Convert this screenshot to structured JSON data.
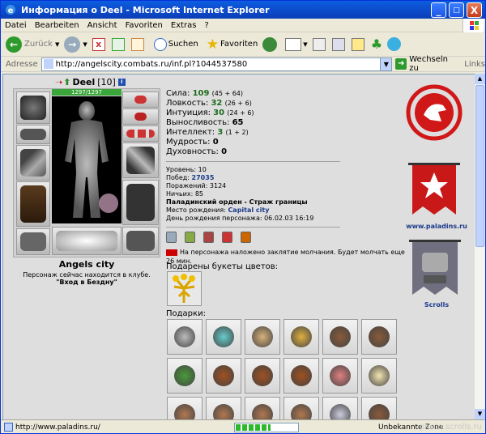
{
  "window": {
    "title": "Информация о Deel - Microsoft Internet Explorer",
    "minimize": "_",
    "maximize": "□",
    "close": "X"
  },
  "menu": [
    "Datei",
    "Bearbeiten",
    "Ansicht",
    "Favoriten",
    "Extras",
    "?"
  ],
  "toolbar": {
    "back": "Zurück",
    "search": "Suchen",
    "favorites": "Favoriten"
  },
  "address": {
    "label": "Adresse",
    "url": "http://angelscity.combats.ru/inf.pl?1044537580",
    "go": "Wechseln zu",
    "links": "Links"
  },
  "character": {
    "name": "Deel",
    "level": "[10]",
    "hp": "1297/1297"
  },
  "location": {
    "city": "Angels city",
    "message": "Персонаж сейчас находится в клубе.",
    "club": "\"Вход в Бездну\""
  },
  "stats": [
    {
      "label": "Сила:",
      "value": "109",
      "mod": "(45 + 64)"
    },
    {
      "label": "Ловкость:",
      "value": "32",
      "mod": "(26 + 6)"
    },
    {
      "label": "Интуиция:",
      "value": "30",
      "mod": "(24 + 6)"
    },
    {
      "label": "Выносливость:",
      "value": "65",
      "mod": ""
    },
    {
      "label": "Интеллект:",
      "value": "3",
      "mod": "(1 + 2)"
    },
    {
      "label": "Мудрость:",
      "value": "0",
      "mod": ""
    },
    {
      "label": "Духовность:",
      "value": "0",
      "mod": ""
    }
  ],
  "info": {
    "level_label": "Уровень:",
    "level": "10",
    "wins_label": "Побед:",
    "wins": "27035",
    "losses_label": "Поражений:",
    "losses": "3124",
    "draws_label": "Ничьих:",
    "draws": "85",
    "order": "Паладинский орден - Страж границы",
    "birthplace_label": "Место рождения:",
    "birthplace": "Capital city",
    "birthday_label": "День рождения персонажа:",
    "birthday": "06.02.03 16:19"
  },
  "silence": "На персонажа наложено заклятие молчания. Будет молчать еще 26 мин.",
  "bouquets_label": "Подарены букеты цветов:",
  "gifts_label": "Подарки:",
  "right": {
    "paladins_link": "www.paladins.ru",
    "scrolls_label": "Scrolls"
  },
  "status": {
    "url": "http://www.paladins.ru/",
    "zone": "Unbekannte Zone",
    "progress": 0.55,
    "watermark": "photo.scrolls.ru"
  },
  "colors": {
    "titlebar": "#0a5fe0",
    "stat_value": "#1f6b1f",
    "link": "#1b3a8a"
  },
  "gifts": [
    "keychain-icon",
    "toothbrush-icon",
    "parchment-icon",
    "ornament-icon",
    "snowglobe-icon",
    "snowglobe-icon",
    "goblin-icon",
    "mace-icon",
    "mace-icon",
    "mace-icon",
    "doll-icon",
    "candle-icon",
    "teddy-bear-icon",
    "teddy-bear-icon",
    "teddy-bear-icon",
    "teddy-bear-icon",
    "snowflake-icon",
    "snowglobe-icon"
  ]
}
